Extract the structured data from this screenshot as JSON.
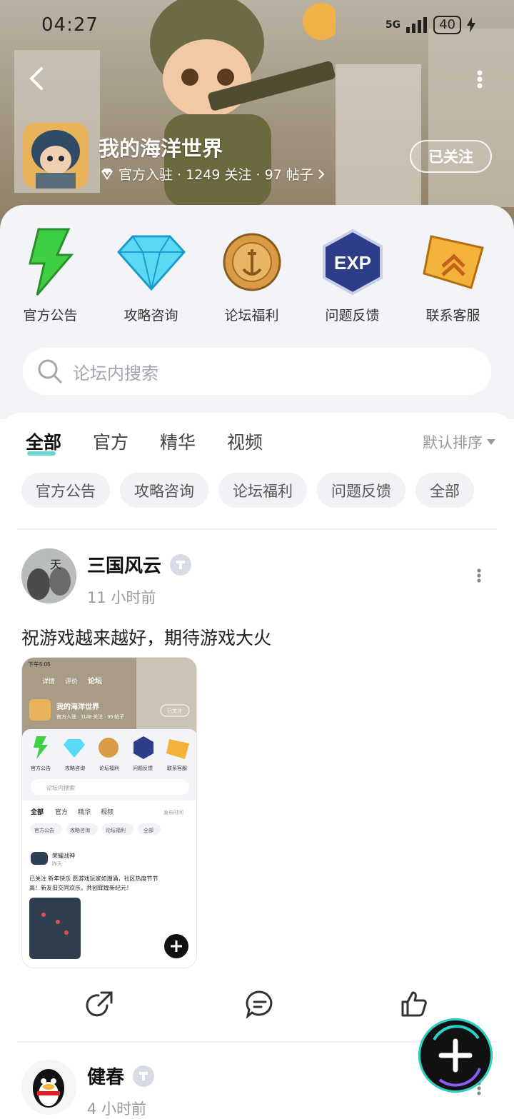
{
  "status_bar": {
    "time": "04:27",
    "network": "5G",
    "battery": "40"
  },
  "header": {
    "game_name": "我的海洋世界",
    "meta": "官方入驻 · 1249 关注 · 97 帖子",
    "follow_label": "已关注"
  },
  "categories": [
    {
      "label": "官方公告",
      "icon": "lightning-icon"
    },
    {
      "label": "攻略咨询",
      "icon": "diamond-icon"
    },
    {
      "label": "论坛福利",
      "icon": "coin-icon"
    },
    {
      "label": "问题反馈",
      "icon": "exp-badge-icon"
    },
    {
      "label": "联系客服",
      "icon": "rank-badge-icon"
    }
  ],
  "search": {
    "placeholder": "论坛内搜索"
  },
  "tabs": [
    {
      "label": "全部",
      "active": true
    },
    {
      "label": "官方"
    },
    {
      "label": "精华"
    },
    {
      "label": "视频"
    }
  ],
  "sort_label": "默认排序",
  "chips": [
    "官方公告",
    "攻略咨询",
    "论坛福利",
    "问题反馈",
    "全部"
  ],
  "posts": [
    {
      "author": "三国风云",
      "time": "11 小时前",
      "text": "祝游戏越来越好，期待游戏大火"
    },
    {
      "author": "健春",
      "time": "4 小时前"
    }
  ],
  "thumbnail": {
    "status_time": "下午5:05",
    "tabs": [
      "详情",
      "评价",
      "论坛"
    ],
    "game_name": "我的海洋世界",
    "meta": "官方入驻 · 1148 关注 · 95 帖子",
    "follow_label": "已关注",
    "categories": [
      "官方公告",
      "攻略咨询",
      "论坛福利",
      "问题反馈",
      "联系客服"
    ],
    "search_placeholder": "论坛内搜索",
    "feed_tabs": [
      "全部",
      "官方",
      "精华",
      "视频"
    ],
    "sort_label": "发布时间",
    "chips": [
      "官方公告",
      "攻略咨询",
      "论坛福利",
      "全部"
    ],
    "post_author": "荣耀战神",
    "post_time": "昨天",
    "post_text_1": "已关注 新年快乐 愿游戏玩家如潮涌，社区热度节节",
    "post_text_2": "高！新友旧交同欢乐，共创辉煌新纪元！"
  },
  "colors": {
    "accent": "#58d3c9",
    "panel_bg": "#f3f4f7",
    "chip_bg": "#f1f2f5"
  }
}
